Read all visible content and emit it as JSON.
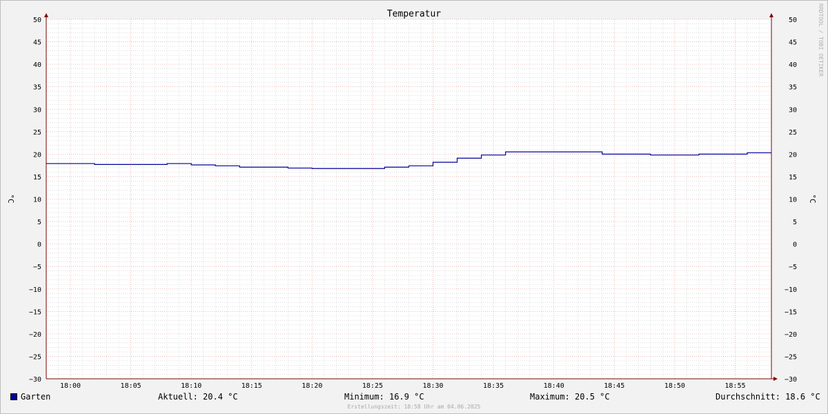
{
  "chart_data": {
    "type": "line",
    "title": "Temperatur",
    "ylabel": "°C",
    "ylabel_right": "°C",
    "ylim": [
      -30,
      50
    ],
    "yticks": [
      50,
      45,
      40,
      35,
      30,
      25,
      20,
      15,
      10,
      5,
      0,
      -5,
      -10,
      -15,
      -20,
      -25,
      -30
    ],
    "xticks": [
      "18:00",
      "18:05",
      "18:10",
      "18:15",
      "18:20",
      "18:25",
      "18:30",
      "18:35",
      "18:40",
      "18:45",
      "18:50",
      "18:55"
    ],
    "xlim": [
      "17:58",
      "18:58"
    ],
    "grid": true,
    "series": [
      {
        "name": "Garten",
        "color": "#000099",
        "step": true,
        "x": [
          "17:58",
          "18:02",
          "18:08",
          "18:10",
          "18:12",
          "18:14",
          "18:18",
          "18:20",
          "18:26",
          "18:28",
          "18:30",
          "18:32",
          "18:34",
          "18:36",
          "18:40",
          "18:44",
          "18:48",
          "18:52",
          "18:56",
          "18:58"
        ],
        "y": [
          17.9,
          17.7,
          17.9,
          17.6,
          17.4,
          17.1,
          16.9,
          16.8,
          17.1,
          17.4,
          18.2,
          19.1,
          19.8,
          20.5,
          20.5,
          20.0,
          19.8,
          20.0,
          20.3,
          20.3
        ]
      }
    ]
  },
  "legend": {
    "series_name": "Garten",
    "current": "Aktuell: 20.4 °C",
    "minimum": "Minimum: 16.9 °C",
    "maximum": "Maximum: 20.5 °C",
    "average": "Durchschnitt: 18.6 °C"
  },
  "watermark": "RRDTOOL / TOBI OETIKER",
  "footer": "Erstellungszeit: 18:58 Uhr am 04.06.2025",
  "colors": {
    "line": "#000099",
    "major_grid": "#e8a8a8",
    "minor_grid": "#c8c8c8",
    "axis": "#800000"
  }
}
